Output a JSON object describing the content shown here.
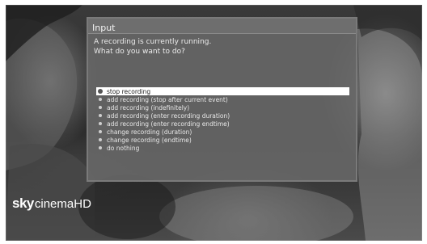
{
  "dialog": {
    "title": "Input",
    "message_line1": "A recording is currently running.",
    "message_line2": "What do you want to do?",
    "options": [
      {
        "label": "stop recording",
        "selected": true
      },
      {
        "label": "add recording (stop after current event)",
        "selected": false
      },
      {
        "label": "add recording (indefinitely)",
        "selected": false
      },
      {
        "label": "add recording (enter recording duration)",
        "selected": false
      },
      {
        "label": "add recording (enter recording endtime)",
        "selected": false
      },
      {
        "label": "change recording (duration)",
        "selected": false
      },
      {
        "label": "change recording (endtime)",
        "selected": false
      },
      {
        "label": "do nothing",
        "selected": false
      }
    ]
  },
  "channel_logo": {
    "brand": "sky",
    "product": "cinema",
    "suffix": "HD"
  },
  "colors": {
    "dialog_bg": "#696969",
    "header_bg": "#6e6e6e",
    "highlight_bg": "#ffffff",
    "text": "#ececec"
  }
}
